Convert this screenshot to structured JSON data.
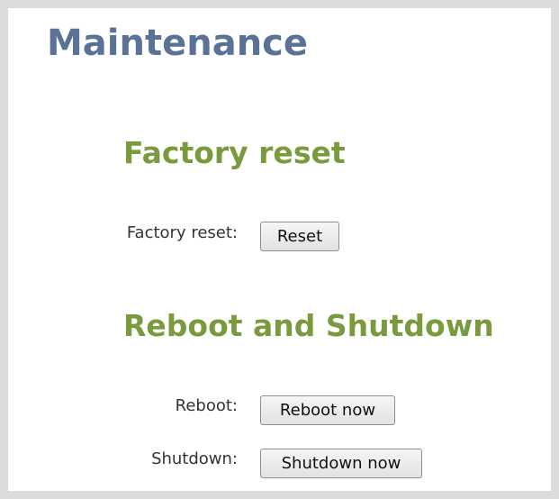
{
  "page": {
    "title": "Maintenance"
  },
  "factory_reset": {
    "heading": "Factory reset",
    "label": "Factory reset:",
    "button": "Reset"
  },
  "reboot_shutdown": {
    "heading": "Reboot and Shutdown",
    "reboot_label": "Reboot:",
    "reboot_button": "Reboot now",
    "shutdown_label": "Shutdown:",
    "shutdown_button": "Shutdown now"
  },
  "colors": {
    "title": "#5b7297",
    "section_heading": "#7a9a3e",
    "frame_border": "#dcdcdc",
    "background": "#ffffff"
  }
}
